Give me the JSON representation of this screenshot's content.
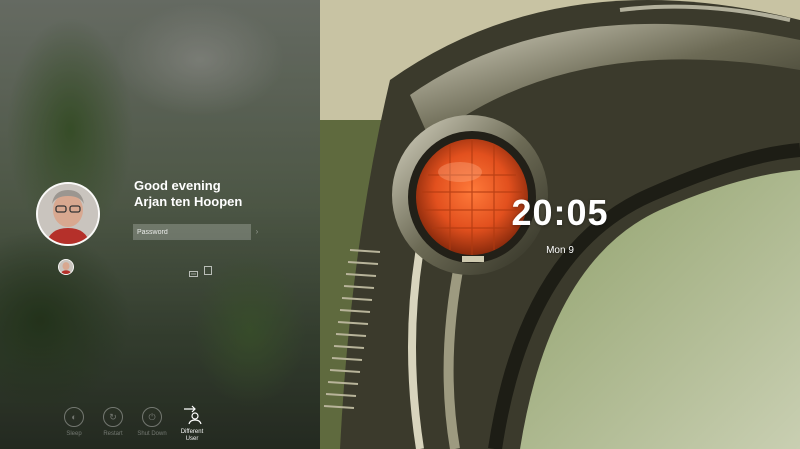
{
  "user": {
    "greeting_line1": "Good evening",
    "greeting_line2": "Arjan ten Hoopen",
    "password_placeholder": "Password"
  },
  "clock": {
    "time": "20:05",
    "date": "Mon 9"
  },
  "actions": [
    {
      "label": "Sleep",
      "icon": "sleep-icon"
    },
    {
      "label": "Restart",
      "icon": "restart-icon"
    },
    {
      "label": "Shut Down",
      "icon": "power-icon"
    },
    {
      "label": "Different User",
      "icon": "switch-user-icon"
    }
  ],
  "colors": {
    "lamp": "#e2501e",
    "text": "#ffffff"
  }
}
